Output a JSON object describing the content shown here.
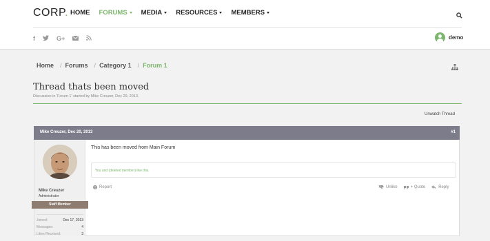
{
  "header": {
    "logo": "CORP",
    "logo_dot": ".",
    "nav": [
      {
        "label": "HOME",
        "caret": false
      },
      {
        "label": "FORUMS",
        "caret": true,
        "active": true
      },
      {
        "label": "MEDIA",
        "caret": true
      },
      {
        "label": "RESOURCES",
        "caret": true
      },
      {
        "label": "MEMBERS",
        "caret": true
      }
    ],
    "social": [
      "f",
      "twitter",
      "G+",
      "mail",
      "rss"
    ],
    "social_labels": {
      "facebook": "f",
      "googleplus": "G+"
    },
    "user_name": "demo"
  },
  "breadcrumb": [
    "Home",
    "Forums",
    "Category 1",
    "Forum 1"
  ],
  "thread": {
    "title": "Thread thats been moved",
    "meta": "Discussion in 'Forum 1' started by Mike Creuzer, Dec 20, 2013.",
    "unwatch": "Unwatch Thread"
  },
  "post": {
    "author_date": "Mike Creuzer, Dec 20, 2013",
    "number": "#1",
    "message": "This has been moved from Main Forum",
    "likes": "You and (deleted member) like this.",
    "report": "Report",
    "actions": [
      "Unlike",
      "+ Quote",
      "Reply"
    ]
  },
  "member": {
    "name": "Mike Creuzer",
    "role": "Administrator",
    "ribbon": "Staff Member",
    "stats": [
      {
        "label": "Joined:",
        "value": "Dec 17, 2013"
      },
      {
        "label": "Messages:",
        "value": "4"
      },
      {
        "label": "Likes Received:",
        "value": "3"
      }
    ]
  },
  "colors": {
    "accent": "#7cb66d",
    "post_header": "#7c7c8a",
    "ribbon": "#8f7c70"
  }
}
